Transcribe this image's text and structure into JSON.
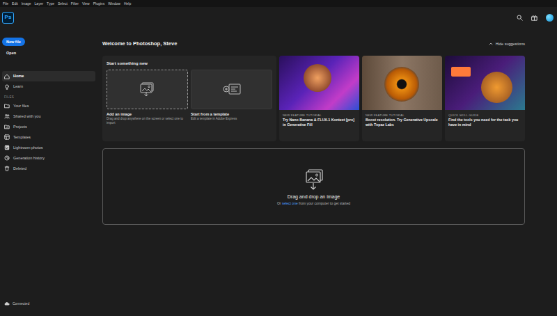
{
  "menu": [
    "File",
    "Edit",
    "Image",
    "Layer",
    "Type",
    "Select",
    "Filter",
    "View",
    "Plugins",
    "Window",
    "Help"
  ],
  "logo": "Ps",
  "sidebar": {
    "buttons": [
      {
        "label": "New file",
        "kind": "primary"
      },
      {
        "label": "Open",
        "kind": "plain"
      }
    ],
    "items": [
      {
        "label": "Home",
        "selected": true
      },
      {
        "label": "Learn",
        "selected": false
      }
    ],
    "section": "FILES",
    "files": [
      "Your files",
      "Shared with you",
      "Projects",
      "Templates",
      "Lightroom photos",
      "Generation history",
      "Deleted"
    ],
    "status": "Connected"
  },
  "welcome": "Welcome to Photoshop, Steve",
  "hide_suggestions": "Hide suggestions",
  "start": {
    "title": "Start something new",
    "cards": [
      {
        "title": "Add an image",
        "description": "Drag and drop anywhere on the screen or select one to import",
        "kind": "upload"
      },
      {
        "title": "Start from a template",
        "description": "Edit a template in Adobe Express",
        "kind": "template"
      }
    ]
  },
  "tutorials": [
    {
      "tag": "NEW FEATURE TUTORIAL",
      "title": "Try Nano Banana & FLUX.1 Kontext [pro] in Generative Fill"
    },
    {
      "tag": "NEW FEATURE TUTORIAL",
      "title": "Boost resolution. Try Generative Upscale with Topaz Labs"
    },
    {
      "tag": "QUICK SKILL GUIDE",
      "title": "Find the tools you need for the task you have in mind"
    }
  ],
  "dropzone": {
    "title": "Drag and drop an image",
    "before": "Or ",
    "link": "select one",
    "after": " from your computer to get started"
  }
}
